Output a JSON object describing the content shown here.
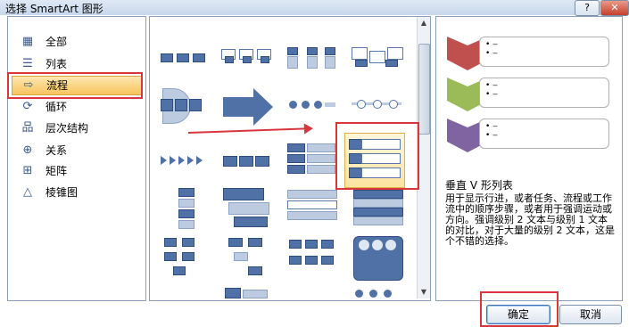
{
  "window": {
    "title": "选择 SmartArt 图形",
    "help_label": "?",
    "close_label": "✕"
  },
  "categories": [
    {
      "label": "全部",
      "icon": "all-icon",
      "glyph": "▦",
      "selected": false
    },
    {
      "label": "列表",
      "icon": "list-icon",
      "glyph": "☰",
      "selected": false
    },
    {
      "label": "流程",
      "icon": "process-icon",
      "glyph": "⇨",
      "selected": true
    },
    {
      "label": "循环",
      "icon": "cycle-icon",
      "glyph": "⟳",
      "selected": false
    },
    {
      "label": "层次结构",
      "icon": "hierarchy-icon",
      "glyph": "品",
      "selected": false
    },
    {
      "label": "关系",
      "icon": "relationship-icon",
      "glyph": "⊕",
      "selected": false
    },
    {
      "label": "矩阵",
      "icon": "matrix-icon",
      "glyph": "⊞",
      "selected": false
    },
    {
      "label": "棱锥图",
      "icon": "pyramid-icon",
      "glyph": "△",
      "selected": false
    }
  ],
  "preview": {
    "bullets": [
      "• ‒",
      "• ‒"
    ],
    "colors": [
      "#c0504d",
      "#9bbb59",
      "#8064a2"
    ],
    "title": "垂直 V 形列表",
    "description": "用于显示行进，或者任务、流程或工作流中的顺序步骤，或者用于强调运动或方向。强调级别 2 文本与级别 1 文本的对比，对于大量的级别 2 文本，这是个不错的选择。"
  },
  "buttons": {
    "ok": "确定",
    "cancel": "取消"
  },
  "colors": {
    "accent": "#4f71a6",
    "highlight": "#d8353c",
    "selection": "#f8c45e"
  }
}
